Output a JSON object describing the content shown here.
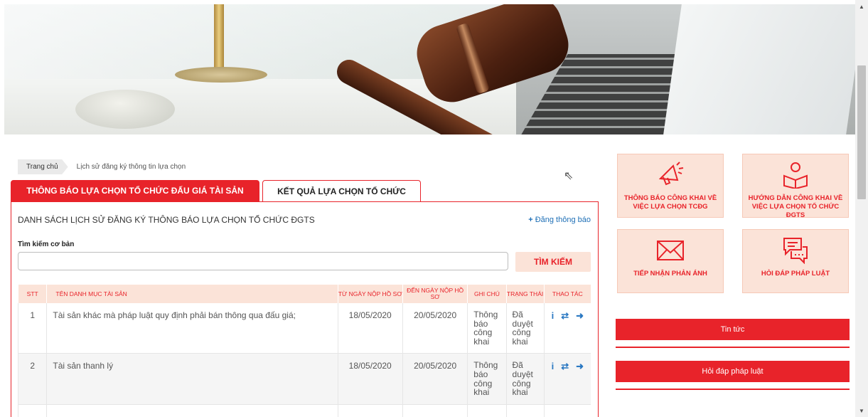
{
  "breadcrumb": {
    "home": "Trang chủ",
    "current": "Lịch sử đăng ký thông tin lựa chọn"
  },
  "tabs": [
    {
      "label": "THÔNG BÁO LỰA CHỌN TỔ CHỨC ĐẤU GIÁ TÀI SẢN",
      "active": true
    },
    {
      "label": "KẾT QUẢ LỰA CHỌN TỔ CHỨC",
      "active": false
    }
  ],
  "panel": {
    "title": "DANH SÁCH LỊCH SỬ ĐĂNG KÝ THÔNG BÁO LỰA CHỌN TỔ CHỨC ĐGTS",
    "post_link": "Đăng thông báo",
    "post_icon": "+"
  },
  "search": {
    "label": "Tìm kiếm cơ bản",
    "value": "",
    "placeholder": "",
    "button": "TÌM KIẾM"
  },
  "table": {
    "headers": {
      "stt": "STT",
      "name": "TÊN DANH MỤC TÀI SẢN",
      "from_date": "TỪ NGÀY NỘP HỒ SƠ",
      "to_date": "ĐẾN NGÀY NỘP HỒ SƠ",
      "note": "GHI CHÚ",
      "status": "TRẠNG THÁI",
      "action": "THAO TÁC"
    },
    "rows": [
      {
        "stt": "1",
        "name": "Tài sản khác mà pháp luật quy định phải bán thông qua đấu giá;",
        "from_date": "18/05/2020",
        "to_date": "20/05/2020",
        "note": "Thông báo công khai",
        "status": "Đã duyệt công khai"
      },
      {
        "stt": "2",
        "name": "Tài sản thanh lý",
        "from_date": "18/05/2020",
        "to_date": "20/05/2020",
        "note": "Thông báo công khai",
        "status": "Đã duyệt công khai"
      }
    ],
    "action_icons": [
      "info-icon",
      "swap-icon",
      "sign-out-icon"
    ]
  },
  "tiles": [
    {
      "label": "THÔNG BÁO CÔNG KHAI VỀ VIỆC LỰA CHỌN TCĐG",
      "icon": "megaphone-icon"
    },
    {
      "label": "HƯỚNG DẪN CÔNG KHAI VỀ VIỆC LỰA CHỌN TỔ CHỨC ĐGTS",
      "icon": "reader-icon"
    },
    {
      "label": "TIẾP NHẬN PHẢN ÁNH",
      "icon": "envelope-icon"
    },
    {
      "label": "HỎI ĐÁP PHÁP LUẬT",
      "icon": "chat-icon"
    }
  ],
  "side_buttons": {
    "news": "Tin tức",
    "faq": "Hỏi đáp pháp luật"
  },
  "colors": {
    "accent": "#e8232a",
    "tile_bg": "#fbe3d8",
    "link": "#1e6fb6",
    "status": "#2ba3d6"
  }
}
